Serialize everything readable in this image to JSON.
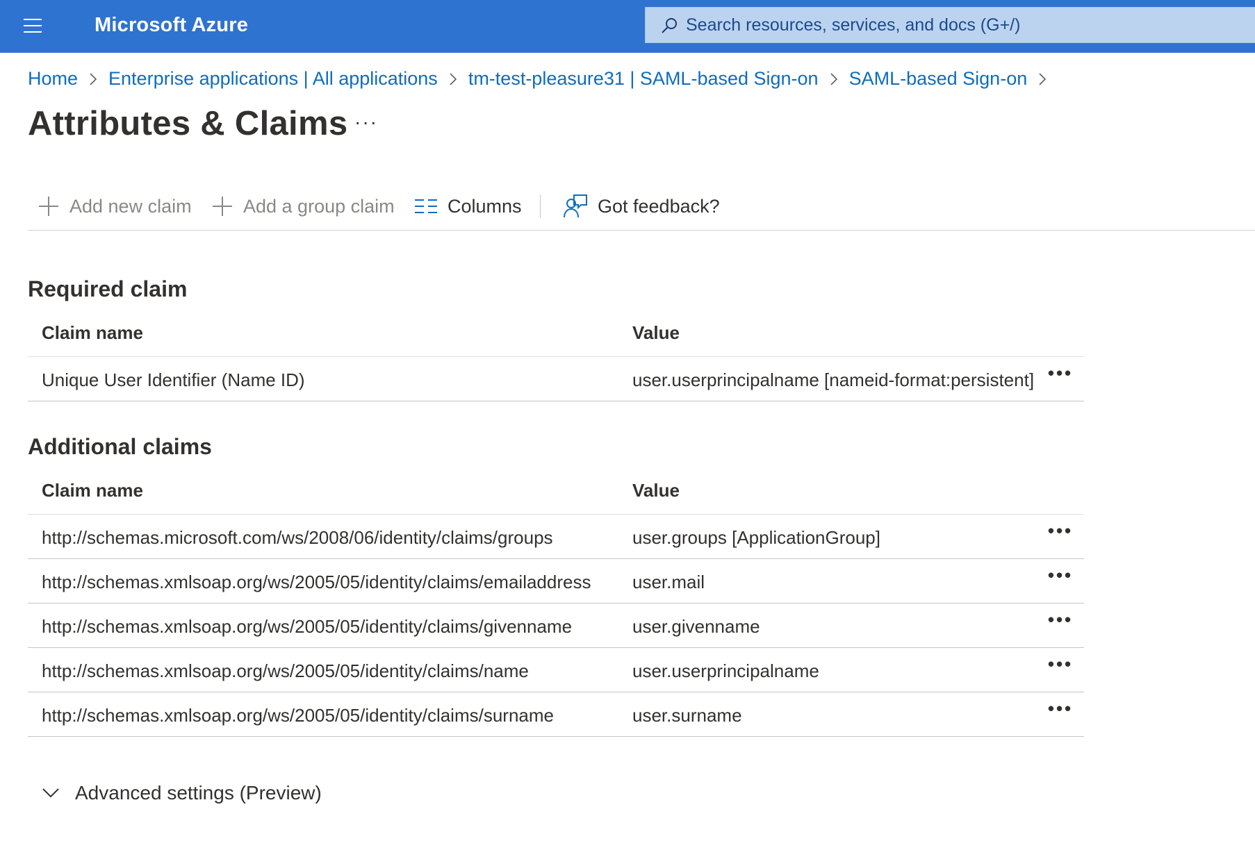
{
  "topbar": {
    "brand": "Microsoft Azure",
    "search_placeholder": "Search resources, services, and docs (G+/)",
    "bg_color": "#2f73d0"
  },
  "breadcrumb": [
    {
      "label": "Home"
    },
    {
      "label": "Enterprise applications | All applications"
    },
    {
      "label": "tm-test-pleasure31 | SAML-based Sign-on"
    },
    {
      "label": "SAML-based Sign-on"
    }
  ],
  "page": {
    "title": "Attributes & Claims",
    "more": "···"
  },
  "toolbar": {
    "add_new_claim": "Add new claim",
    "add_group_claim": "Add a group claim",
    "columns": "Columns",
    "feedback": "Got feedback?"
  },
  "required": {
    "title": "Required claim",
    "col_name": "Claim name",
    "col_value": "Value",
    "rows": [
      {
        "name": "Unique User Identifier (Name ID)",
        "value": "user.userprincipalname [nameid-format:persistent]"
      }
    ]
  },
  "additional": {
    "title": "Additional claims",
    "col_name": "Claim name",
    "col_value": "Value",
    "rows": [
      {
        "name": "http://schemas.microsoft.com/ws/2008/06/identity/claims/groups",
        "value": "user.groups [ApplicationGroup]"
      },
      {
        "name": "http://schemas.xmlsoap.org/ws/2005/05/identity/claims/emailaddress",
        "value": "user.mail"
      },
      {
        "name": "http://schemas.xmlsoap.org/ws/2005/05/identity/claims/givenname",
        "value": "user.givenname"
      },
      {
        "name": "http://schemas.xmlsoap.org/ws/2005/05/identity/claims/name",
        "value": "user.userprincipalname"
      },
      {
        "name": "http://schemas.xmlsoap.org/ws/2005/05/identity/claims/surname",
        "value": "user.surname"
      }
    ]
  },
  "row_more": "•••",
  "advanced": {
    "label": "Advanced settings (Preview)"
  },
  "icons": {
    "menu": "hamburger-menu-icon",
    "search": "search-icon",
    "plus": "plus-icon",
    "columns": "columns-icon",
    "feedback": "feedback-icon",
    "chevron": "chevron-right-icon",
    "expand": "chevron-down-icon"
  }
}
